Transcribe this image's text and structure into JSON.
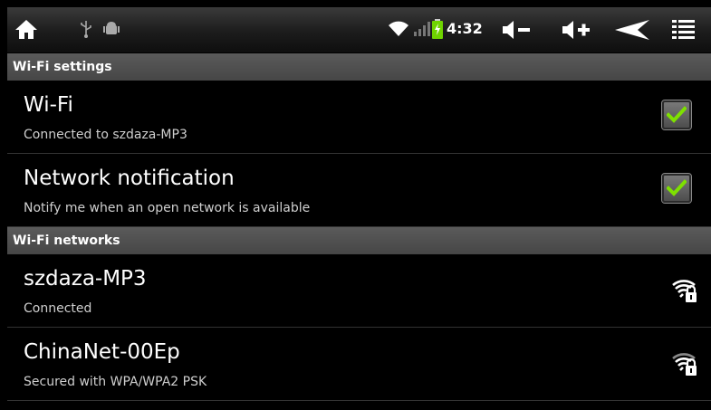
{
  "status_bar": {
    "time": "4:32",
    "icons": [
      "home-icon",
      "usb-icon",
      "android-debug-icon",
      "wifi-signal-icon",
      "cell-signal-icon",
      "battery-charging-icon",
      "volume-down-icon",
      "volume-up-icon",
      "back-icon",
      "menu-icon"
    ]
  },
  "sections": {
    "wifi_settings": "Wi-Fi settings",
    "wifi_networks": "Wi-Fi networks"
  },
  "settings": [
    {
      "title": "Wi-Fi",
      "subtitle": "Connected to szdaza-MP3",
      "checked": true
    },
    {
      "title": "Network notification",
      "subtitle": "Notify me when an open network is available",
      "checked": true
    }
  ],
  "networks": [
    {
      "ssid": "szdaza-MP3",
      "status": "Connected",
      "icon": "wifi-locked-icon"
    },
    {
      "ssid": "ChinaNet-00Ep",
      "status": "Secured with WPA/WPA2 PSK",
      "icon": "wifi-locked-icon"
    }
  ],
  "colors": {
    "background": "#000000",
    "header": "#505050",
    "check_green": "#7ee000",
    "battery_green": "#6fd400"
  }
}
